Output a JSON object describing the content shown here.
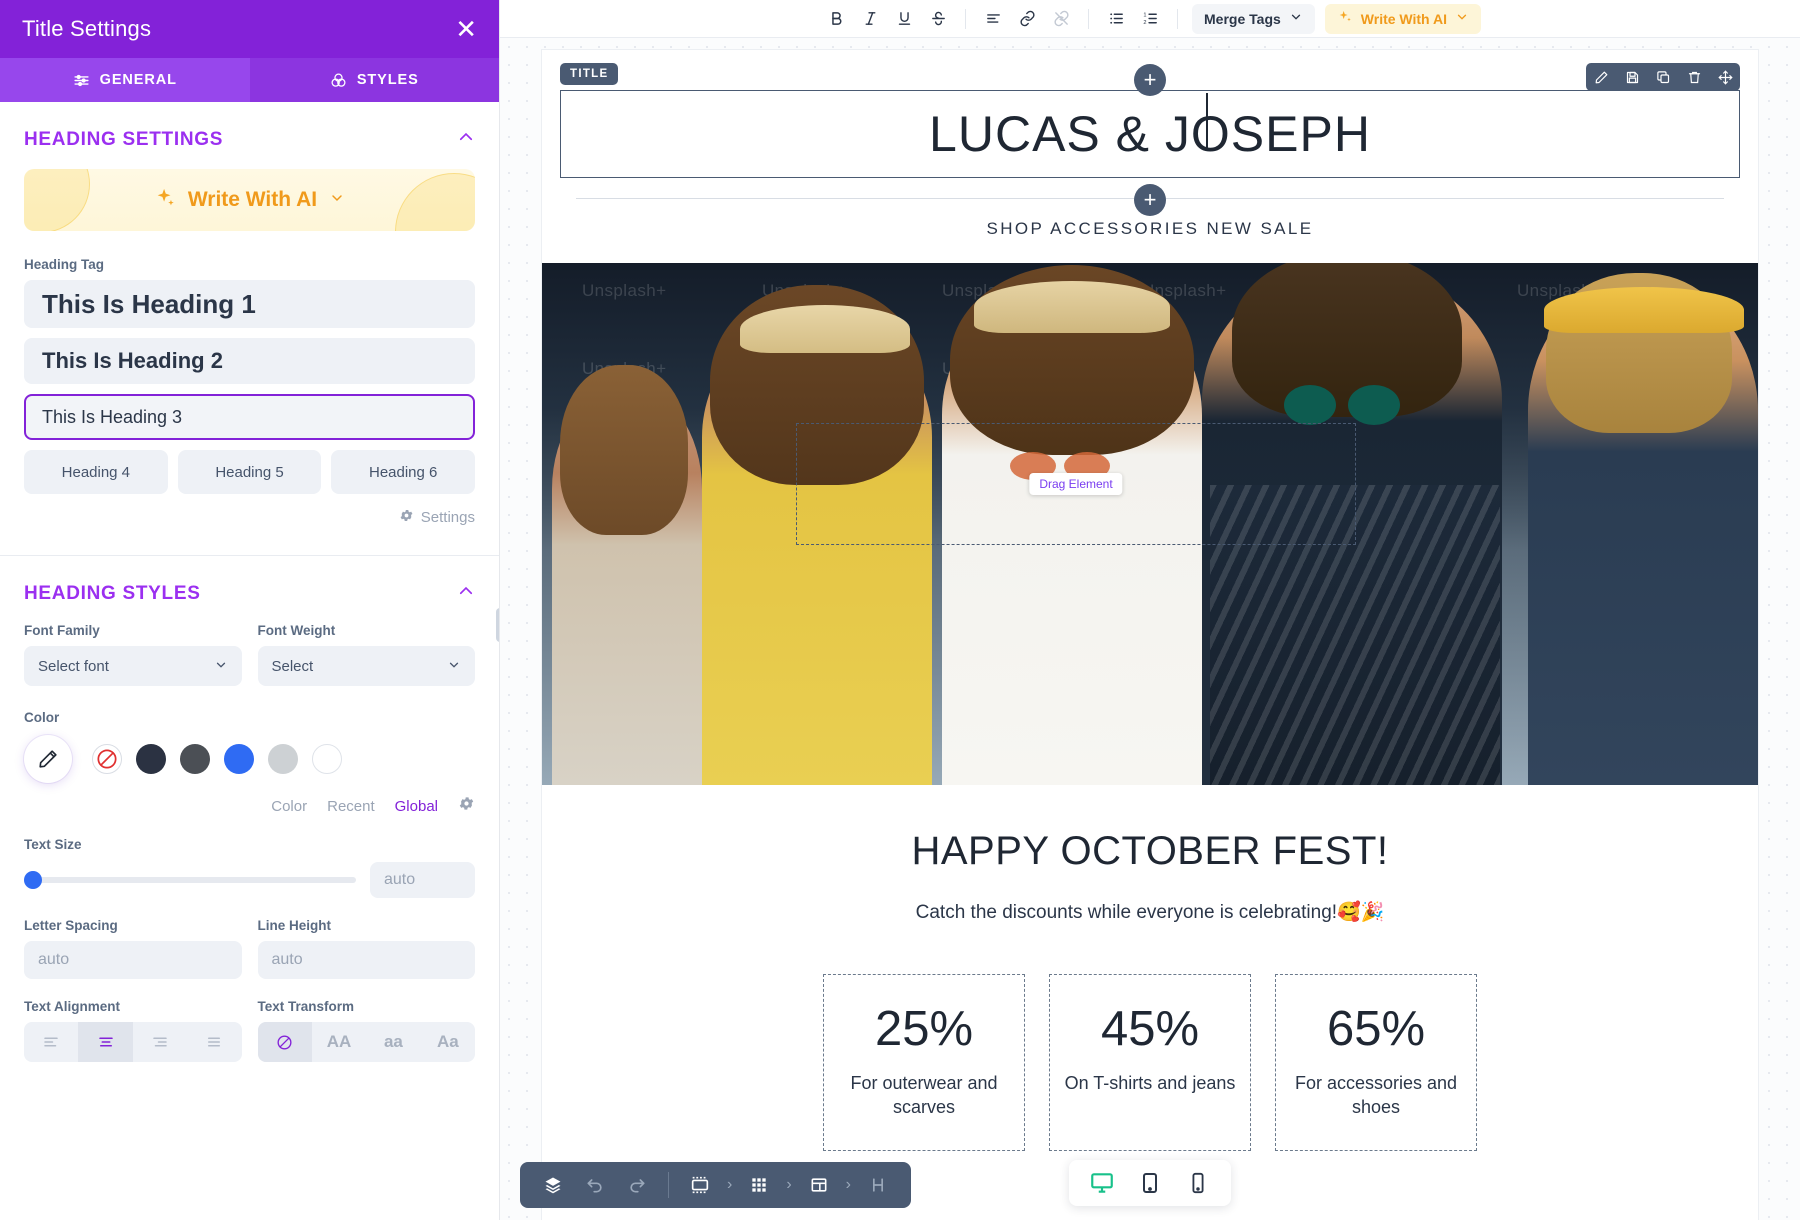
{
  "sidebar": {
    "title": "Title Settings",
    "close_icon": "close-icon",
    "tabs": [
      {
        "label": "GENERAL",
        "icon": "sliders-icon",
        "active": true
      },
      {
        "label": "STYLES",
        "icon": "color-circles-icon",
        "active": false
      }
    ],
    "heading_settings": {
      "section_title": "HEADING SETTINGS",
      "ai_button": "Write With AI",
      "heading_tag_label": "Heading Tag",
      "options": [
        {
          "label": "This Is Heading 1",
          "selected": false
        },
        {
          "label": "This Is Heading 2",
          "selected": false
        },
        {
          "label": "This Is Heading 3",
          "selected": true
        },
        {
          "label": "Heading 4",
          "selected": false
        },
        {
          "label": "Heading 5",
          "selected": false
        },
        {
          "label": "Heading 6",
          "selected": false
        }
      ],
      "settings_link": "Settings"
    },
    "heading_styles": {
      "section_title": "HEADING STYLES",
      "font_family_label": "Font Family",
      "font_family_value": "Select font",
      "font_weight_label": "Font Weight",
      "font_weight_value": "Select",
      "color_label": "Color",
      "swatches": [
        {
          "name": "no-color",
          "hex": "none"
        },
        {
          "name": "dark-navy",
          "hex": "#2b3242"
        },
        {
          "name": "dark-gray",
          "hex": "#4b4f55"
        },
        {
          "name": "blue",
          "hex": "#2f6bf3"
        },
        {
          "name": "light-gray",
          "hex": "#cdd1d4"
        },
        {
          "name": "white",
          "hex": "#ffffff"
        }
      ],
      "color_tabs": [
        {
          "label": "Color",
          "active": false
        },
        {
          "label": "Recent",
          "active": false
        },
        {
          "label": "Global",
          "active": true
        }
      ],
      "text_size_label": "Text Size",
      "text_size_value": "auto",
      "letter_spacing_label": "Letter Spacing",
      "letter_spacing_value": "auto",
      "line_height_label": "Line Height",
      "line_height_value": "auto",
      "text_alignment_label": "Text Alignment",
      "text_alignment_options": [
        "left",
        "center",
        "right",
        "justify"
      ],
      "text_alignment_selected": "center",
      "text_transform_label": "Text Transform",
      "text_transform_options": [
        "none",
        "AA",
        "aa",
        "Aa"
      ],
      "text_transform_selected": "none"
    }
  },
  "toolbar": {
    "buttons": [
      {
        "name": "bold-icon",
        "label": "B"
      },
      {
        "name": "italic-icon",
        "label": "I"
      },
      {
        "name": "underline-icon",
        "label": "U"
      },
      {
        "name": "strikethrough-icon",
        "label": "S"
      },
      {
        "name": "align-icon",
        "label": "align"
      },
      {
        "name": "link-icon",
        "label": "link"
      },
      {
        "name": "unlink-icon",
        "label": "unlink"
      },
      {
        "name": "bullet-list-icon",
        "label": "bullets"
      },
      {
        "name": "numbered-list-icon",
        "label": "numbers"
      }
    ],
    "merge_tags": "Merge Tags",
    "write_with_ai": "Write With AI"
  },
  "canvas": {
    "element_badge": "TITLE",
    "title_text": "LUCAS & JOSEPH",
    "subtitle_text": "SHOP ACCESSORIES NEW SALE",
    "element_tools": [
      "edit-icon",
      "save-icon",
      "duplicate-icon",
      "delete-icon",
      "move-icon"
    ],
    "add_button": "+",
    "drag_element_label": "Drag Element",
    "hero_watermark": "Unsplash+",
    "promo_heading": "HAPPY OCTOBER FEST!",
    "promo_subtext": "Catch the discounts while everyone is celebrating!🥰🎉",
    "discount_cards": [
      {
        "percent": "25%",
        "text": "For outerwear and scarves"
      },
      {
        "percent": "45%",
        "text": "On T-shirts and jeans"
      },
      {
        "percent": "65%",
        "text": "For accessories and shoes"
      }
    ]
  },
  "bottom_bar": {
    "items": [
      {
        "name": "layers-icon"
      },
      {
        "name": "undo-icon"
      },
      {
        "name": "redo-icon"
      },
      {
        "name": "body-icon"
      },
      {
        "name": "grid-icon"
      },
      {
        "name": "layout-icon"
      },
      {
        "name": "heading-icon",
        "label": "H"
      }
    ]
  },
  "device_bar": {
    "devices": [
      {
        "name": "desktop-icon",
        "active": true
      },
      {
        "name": "tablet-icon",
        "active": false
      },
      {
        "name": "mobile-icon",
        "active": false
      }
    ]
  },
  "colors": {
    "brand_purple": "#8322d8",
    "accent_orange": "#f09a1b",
    "accent_blue": "#2f6bf3",
    "dark_slate": "#4a5a72",
    "active_green": "#18c18a"
  }
}
